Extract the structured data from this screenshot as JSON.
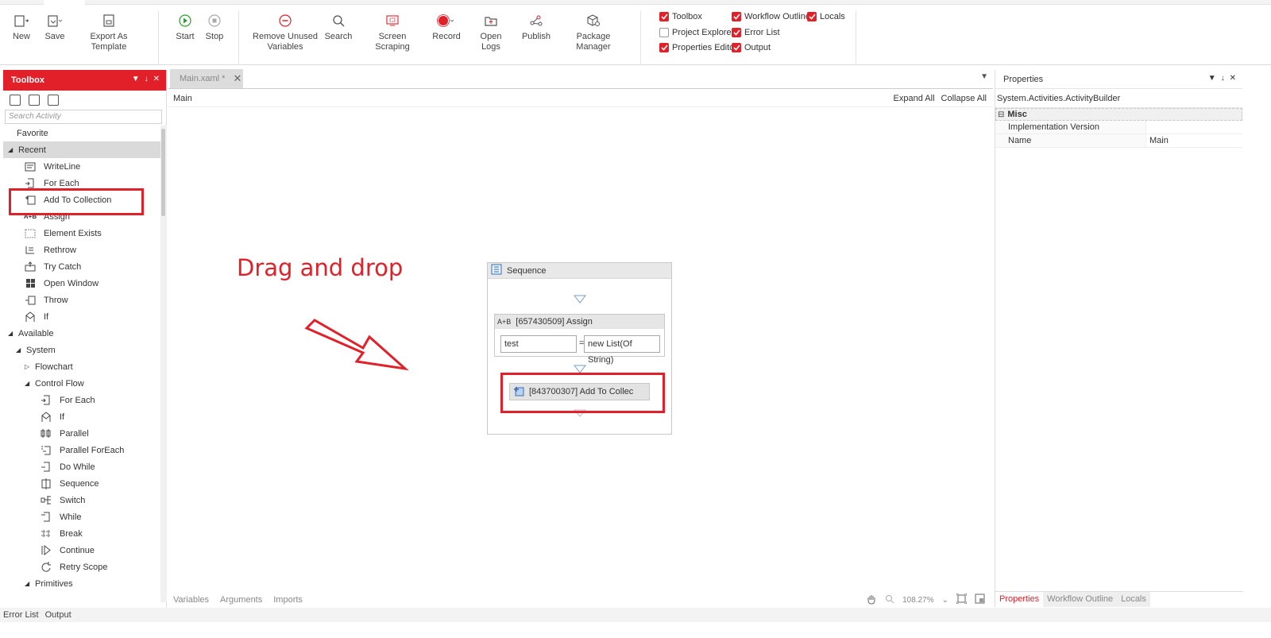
{
  "ribbon": {
    "buttons": [
      {
        "label": "New",
        "icon": "new-file-icon"
      },
      {
        "label": "Save",
        "icon": "save-icon"
      },
      {
        "label": "Export As Template",
        "icon": "export-template-icon"
      },
      {
        "label": "Start",
        "icon": "play-icon"
      },
      {
        "label": "Stop",
        "icon": "stop-icon"
      },
      {
        "label": "Remove Unused Variables",
        "icon": "remove-icon"
      },
      {
        "label": "Search",
        "icon": "search-icon"
      },
      {
        "label": "Screen Scraping",
        "icon": "screen-scraping-icon"
      },
      {
        "label": "Record",
        "icon": "record-icon"
      },
      {
        "label": "Open Logs",
        "icon": "open-logs-icon"
      },
      {
        "label": "Publish",
        "icon": "publish-icon"
      },
      {
        "label": "Package Manager",
        "icon": "package-manager-icon"
      }
    ],
    "checkboxes": [
      {
        "label": "Toolbox",
        "checked": true
      },
      {
        "label": "Project Explorer",
        "checked": false
      },
      {
        "label": "Properties Editor",
        "checked": true
      },
      {
        "label": "Workflow Outline",
        "checked": true
      },
      {
        "label": "Error List",
        "checked": true
      },
      {
        "label": "Output",
        "checked": true
      },
      {
        "label": "Locals",
        "checked": true
      }
    ]
  },
  "toolbox": {
    "title": "Toolbox",
    "search_placeholder": "Search Activity",
    "favorite": "Favorite",
    "recent": "Recent",
    "recent_items": [
      "WriteLine",
      "For Each",
      "Add To Collection",
      "Assign",
      "Element Exists",
      "Rethrow",
      "Try Catch",
      "Open Window",
      "Throw",
      "If"
    ],
    "available": "Available",
    "system": "System",
    "flowchart": "Flowchart",
    "control_flow": "Control Flow",
    "control_flow_items": [
      "For Each",
      "If",
      "Parallel",
      "Parallel ForEach",
      "Do While",
      "Sequence",
      "Switch",
      "While",
      "Break",
      "Continue",
      "Retry Scope"
    ],
    "primitives": "Primitives"
  },
  "document": {
    "tab": "Main.xaml *",
    "breadcrumb": "Main",
    "expand_all": "Expand All",
    "collapse_all": "Collapse All"
  },
  "annotation": {
    "text": "Drag and drop",
    "color": "#e2202a"
  },
  "sequence": {
    "title": "Sequence",
    "assign_title": "[657430509] Assign",
    "assign_icon_text": "A+B",
    "assign_to": "test",
    "assign_eq": "=",
    "assign_value": "new List(Of String)",
    "add_collection_title": "[843700307] Add To Collec"
  },
  "canvas_footer": {
    "tabs": [
      "Variables",
      "Arguments",
      "Imports"
    ],
    "zoom": "108.27%"
  },
  "properties": {
    "title": "Properties",
    "type": "System.Activities.ActivityBuilder",
    "category": "Misc",
    "rows": [
      {
        "key": "Implementation Version",
        "value": ""
      },
      {
        "key": "Name",
        "value": "Main"
      }
    ],
    "footer_tabs": [
      "Properties",
      "Workflow Outline",
      "Locals"
    ]
  },
  "bottom_tabs": [
    "Error List",
    "Output"
  ],
  "colors": {
    "accent": "#e2202a"
  }
}
